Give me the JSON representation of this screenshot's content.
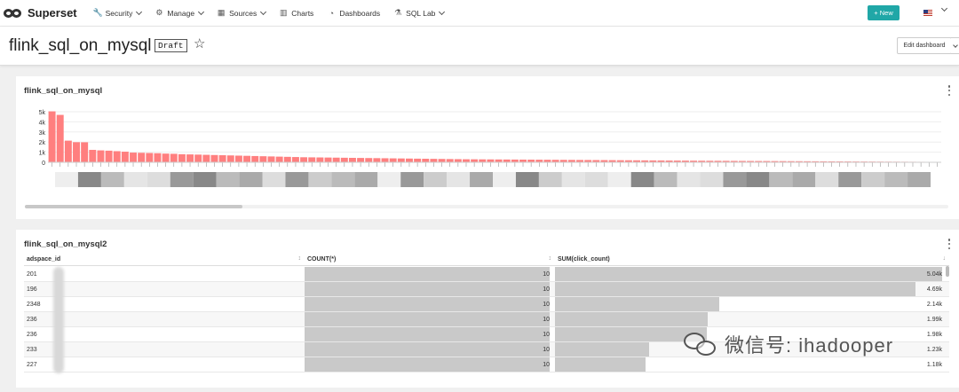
{
  "navbar": {
    "brand": "Superset",
    "items": [
      {
        "label": "Security",
        "icon": "wrench-icon",
        "glyph": "🔧",
        "dropdown": true
      },
      {
        "label": "Manage",
        "icon": "gear-icon",
        "glyph": "⚙",
        "dropdown": true
      },
      {
        "label": "Sources",
        "icon": "database-icon",
        "glyph": "▦",
        "dropdown": true
      },
      {
        "label": "Charts",
        "icon": "bar-chart-icon",
        "glyph": "▥",
        "dropdown": false
      },
      {
        "label": "Dashboards",
        "icon": "dashboard-icon",
        "glyph": "◔",
        "dropdown": false
      },
      {
        "label": "SQL Lab",
        "icon": "flask-icon",
        "glyph": "⚗",
        "dropdown": true
      }
    ],
    "new_button": "+ New",
    "new_button_color": "#20a7a7"
  },
  "header": {
    "title": "flink_sql_on_mysql",
    "status_badge": "Draft",
    "edit_button": "Edit dashboard"
  },
  "panel1": {
    "title": "flink_sql_on_mysql"
  },
  "panel2": {
    "title": "flink_sql_on_mysql2",
    "columns": [
      "adspace_id",
      "COUNT(*)",
      "SUM(click_count)"
    ],
    "rows": [
      {
        "id": "201",
        "count": "10",
        "sum": "5.04k",
        "sum_value": 5040
      },
      {
        "id": "196",
        "count": "10",
        "sum": "4.69k",
        "sum_value": 4690
      },
      {
        "id": "2348",
        "count": "10",
        "sum": "2.14k",
        "sum_value": 2140
      },
      {
        "id": "236",
        "count": "10",
        "sum": "1.99k",
        "sum_value": 1990
      },
      {
        "id": "236",
        "count": "10",
        "sum": "1.98k",
        "sum_value": 1980
      },
      {
        "id": "233",
        "count": "10",
        "sum": "1.23k",
        "sum_value": 1230
      },
      {
        "id": "227",
        "count": "10",
        "sum": "1.18k",
        "sum_value": 1180
      }
    ],
    "max_sum": 5040
  },
  "chart_data": {
    "type": "bar",
    "ylim": [
      0,
      5000
    ],
    "yticks": [
      "0",
      "1k",
      "2k",
      "3k",
      "4k",
      "5k"
    ],
    "values": [
      5040,
      4690,
      2140,
      1990,
      1980,
      1230,
      1180,
      1150,
      1100,
      1050,
      960,
      940,
      920,
      900,
      860,
      840,
      800,
      780,
      760,
      740,
      720,
      700,
      680,
      660,
      640,
      620,
      600,
      580,
      560,
      540,
      520,
      500,
      490,
      480,
      470,
      460,
      450,
      440,
      430,
      420,
      410,
      400,
      390,
      380,
      370,
      360,
      350,
      340,
      330,
      320,
      310,
      300,
      295,
      290,
      285,
      280,
      275,
      270,
      265,
      260,
      255,
      250,
      245,
      240,
      235,
      230,
      225,
      220,
      215,
      210,
      205,
      200,
      195,
      190,
      185,
      180,
      175,
      170,
      165,
      160,
      155,
      150,
      146,
      142,
      138,
      134,
      130,
      126,
      122,
      118,
      114,
      110,
      106,
      102,
      98,
      94,
      90,
      86,
      82,
      78,
      74,
      70,
      66,
      62,
      58,
      54,
      50,
      46,
      42,
      38
    ],
    "bar_color": "#ff7f7f",
    "grid": true
  }
}
